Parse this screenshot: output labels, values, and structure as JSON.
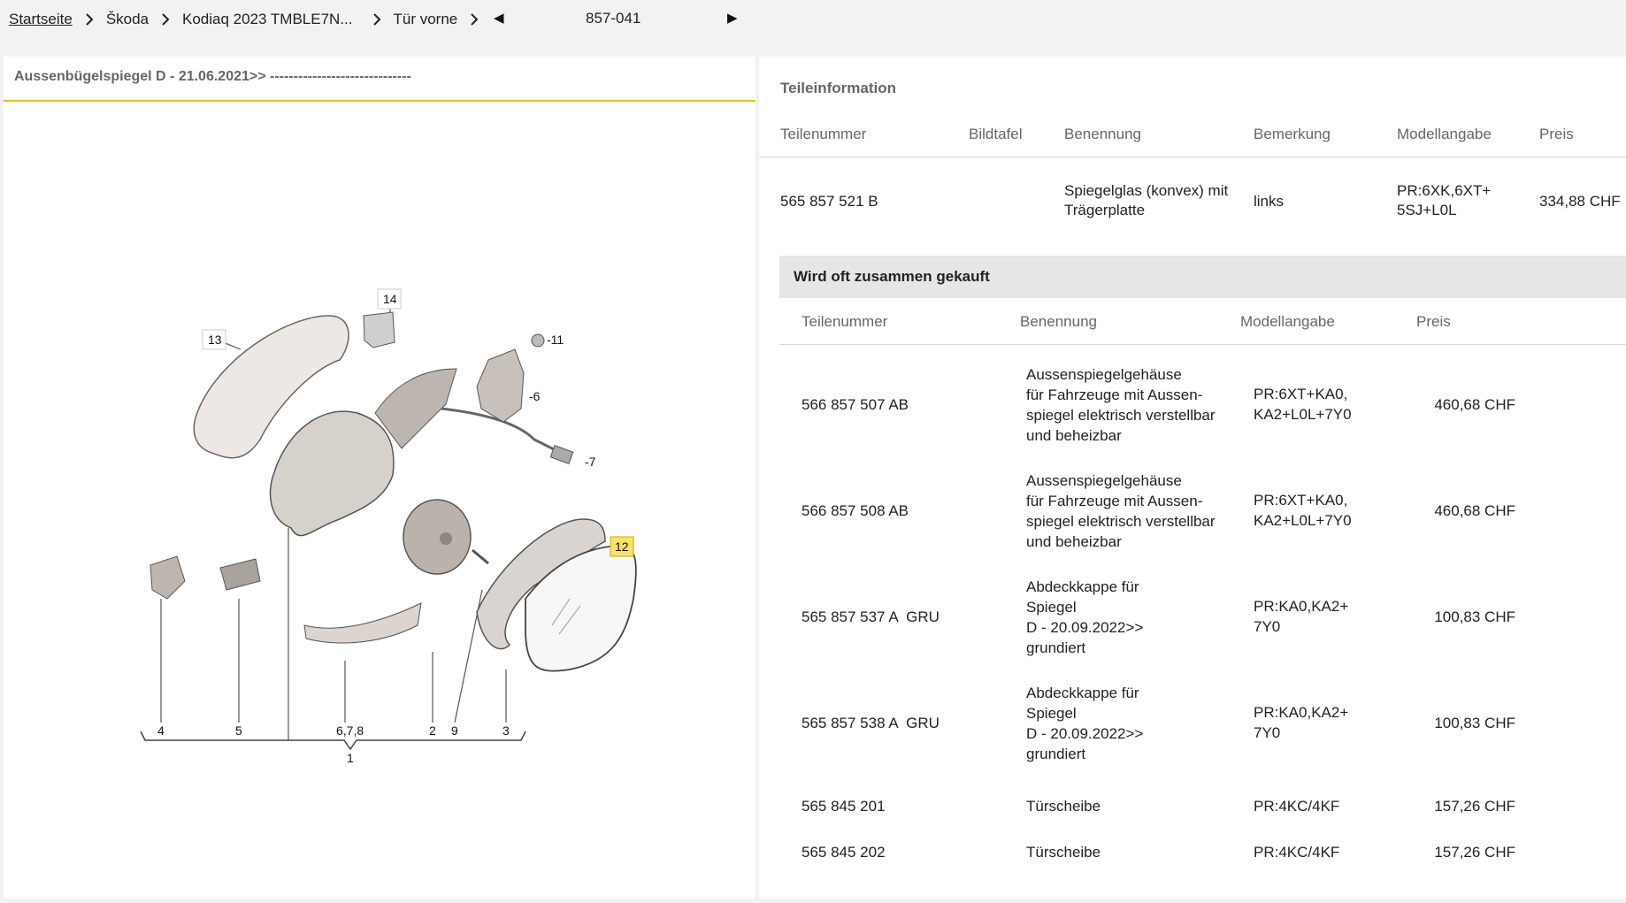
{
  "breadcrumb": {
    "items": [
      "Startseite",
      "Škoda",
      "Kodiaq 2023 TMBLE7N...",
      "Tür vorne"
    ],
    "part_code": "857-041",
    "prev_label": "◀",
    "next_label": "▶"
  },
  "diagram": {
    "title": "Aussenbügelspiegel D - 21.06.2021>> ------------------------------",
    "callouts": [
      "14",
      "13",
      "-11",
      "-6",
      "-7",
      "12",
      "4",
      "5",
      "6,7,8",
      "2",
      "9",
      "3",
      "1"
    ],
    "highlighted_callout": "12",
    "accent_color": "#e8c21c"
  },
  "teileinformation": {
    "title": "Teileinformation",
    "headers": [
      "Teilenummer",
      "Bildtafel",
      "Benennung",
      "Bemerkung",
      "Modellangabe",
      "Preis"
    ],
    "row": {
      "teilenummer": "565 857 521 B",
      "bildtafel": "",
      "benennung_1": "Spiegelglas (konvex) mit",
      "benennung_2": "Trägerplatte",
      "bemerkung": "links",
      "modell_1": "PR:6XK,6XT+",
      "modell_2": "5SJ+L0L",
      "preis": "334,88 CHF"
    }
  },
  "oft_gekauft": {
    "title": "Wird oft zusammen gekauft",
    "headers": [
      "Teilenummer",
      "Benennung",
      "Modellangabe",
      "Preis"
    ],
    "rows": [
      {
        "nr": "566 857 507 AB",
        "ben": [
          "Aussenspiegelgehäuse",
          "für Fahrzeuge mit Aussen-",
          "spiegel elektrisch verstellbar",
          "und beheizbar"
        ],
        "mod": [
          "PR:6XT+KA0,",
          "KA2+L0L+7Y0"
        ],
        "preis": "460,68 CHF"
      },
      {
        "nr": "566 857 508 AB",
        "ben": [
          "Aussenspiegelgehäuse",
          "für Fahrzeuge mit Aussen-",
          "spiegel elektrisch verstellbar",
          "und beheizbar"
        ],
        "mod": [
          "PR:6XT+KA0,",
          "KA2+L0L+7Y0"
        ],
        "preis": "460,68 CHF"
      },
      {
        "nr": "565 857 537 A  GRU",
        "ben": [
          "Abdeckkappe für",
          "Spiegel",
          "D - 20.09.2022>>",
          "grundiert"
        ],
        "mod": [
          "PR:KA0,KA2+",
          "7Y0"
        ],
        "preis": "100,83 CHF"
      },
      {
        "nr": "565 857 538 A  GRU",
        "ben": [
          "Abdeckkappe für",
          "Spiegel",
          "D - 20.09.2022>>",
          "grundiert"
        ],
        "mod": [
          "PR:KA0,KA2+",
          "7Y0"
        ],
        "preis": "100,83 CHF"
      },
      {
        "nr": "565 845 201",
        "ben": [
          "Türscheibe"
        ],
        "mod": [
          "PR:4KC/4KF"
        ],
        "preis": "157,26 CHF"
      },
      {
        "nr": "565 845 202",
        "ben": [
          "Türscheibe"
        ],
        "mod": [
          "PR:4KC/4KF"
        ],
        "preis": "157,26 CHF"
      }
    ]
  }
}
